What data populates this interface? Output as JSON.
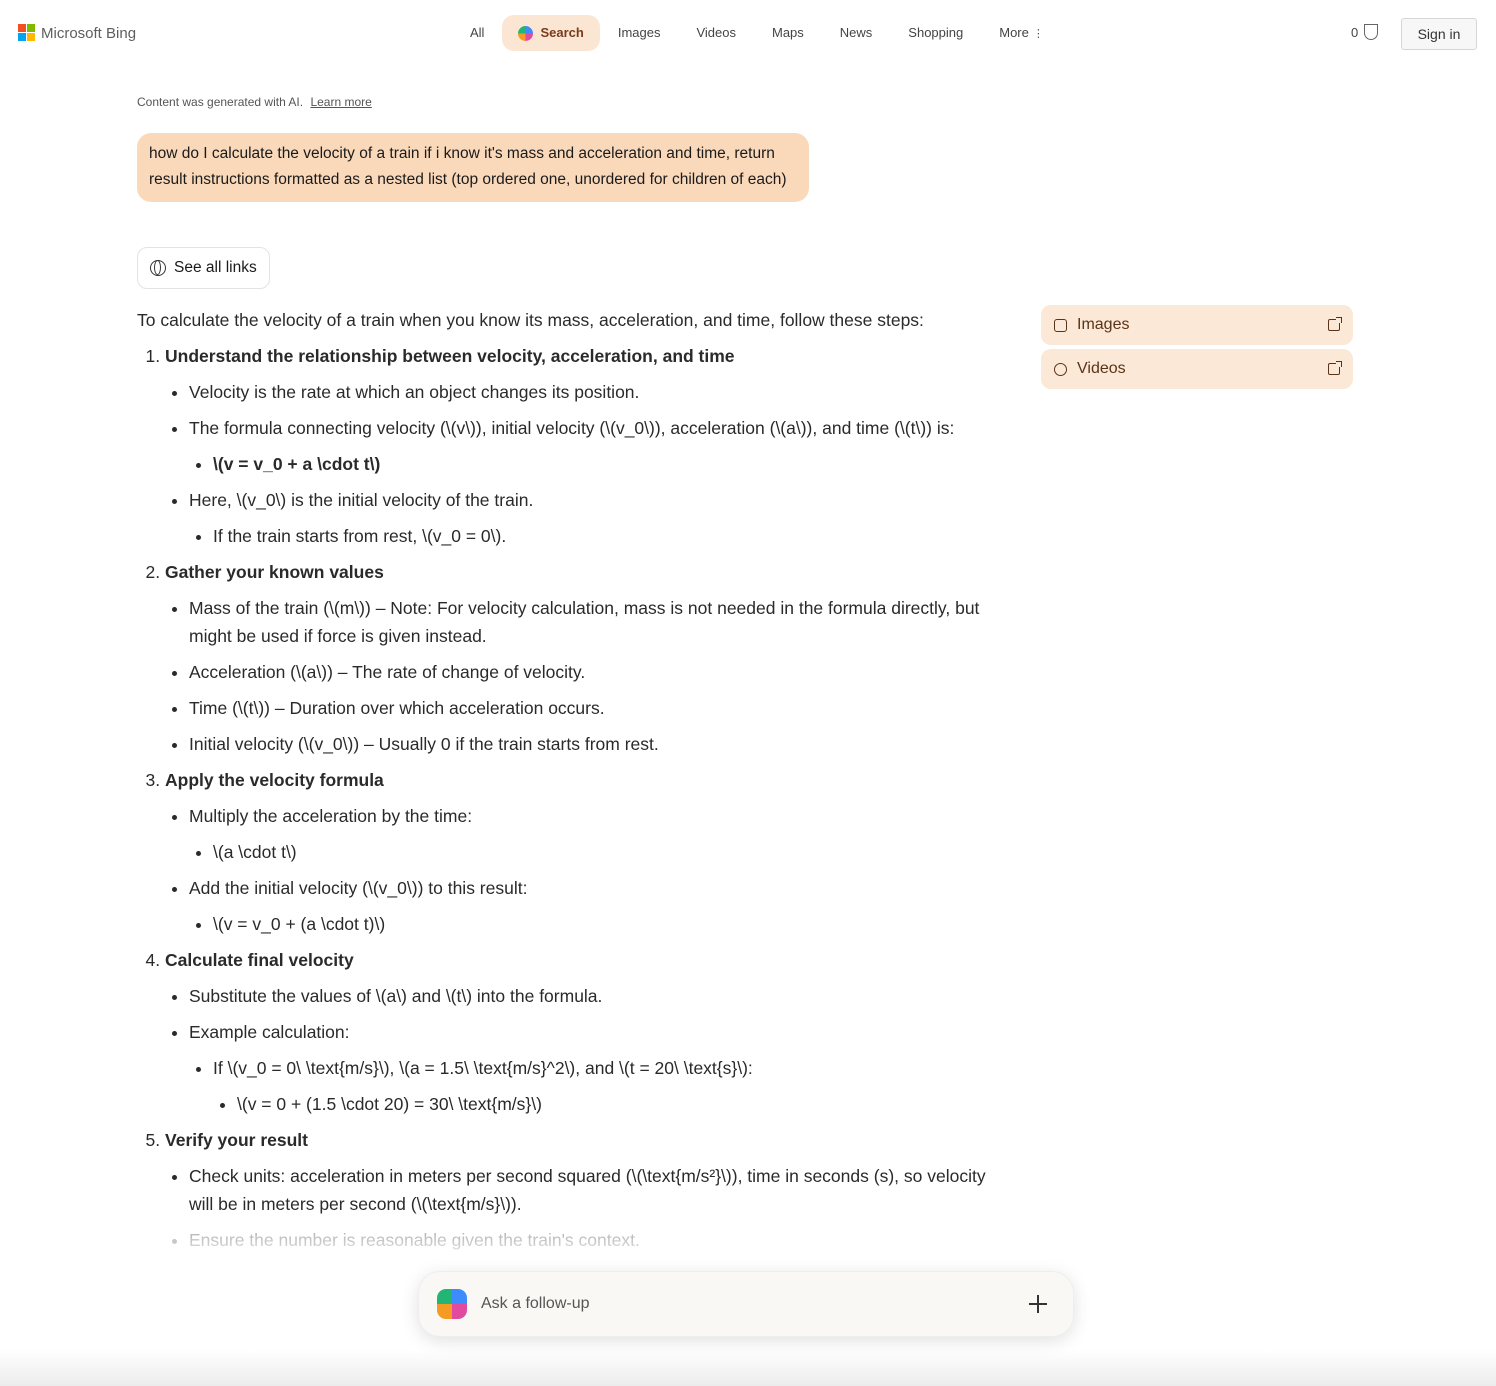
{
  "header": {
    "logo_text": "Microsoft Bing",
    "logo_colors": [
      "#f25022",
      "#7fba00",
      "#00a4ef",
      "#ffb900"
    ],
    "nav": [
      {
        "label": "All"
      },
      {
        "label": "Search",
        "active": true
      },
      {
        "label": "Images"
      },
      {
        "label": "Videos"
      },
      {
        "label": "Maps"
      },
      {
        "label": "News"
      },
      {
        "label": "Shopping"
      },
      {
        "label": "More"
      }
    ],
    "rewards_count": "0",
    "sign_in": "Sign in"
  },
  "notice": {
    "text": "Content was generated with AI.",
    "link": "Learn more"
  },
  "query": {
    "text": "how do I calculate the velocity of a train if i know it's mass and acceleration and time, return result instructions formatted as a nested list (top ordered one, unordered for children of each)"
  },
  "see_all_links": "See all links",
  "answer": {
    "intro": "To calculate the velocity of a train when you know its mass, acceleration, and time, follow these steps:",
    "steps": [
      {
        "title": "Understand the relationship between velocity, acceleration, and time",
        "b1": "Velocity is the rate at which an object changes its position.",
        "b2": "The formula connecting velocity (\\(v\\)), initial velocity (\\(v_0\\)), acceleration (\\(a\\)), and time (\\(t\\)) is:",
        "b2_sub": "\\(v = v_0 + a \\cdot t\\)",
        "b3": "Here, \\(v_0\\) is the initial velocity of the train.",
        "b3_sub": "If the train starts from rest, \\(v_0 = 0\\)."
      },
      {
        "title": "Gather your known values",
        "b1": "Mass of the train (\\(m\\)) – Note: For velocity calculation, mass is not needed in the formula directly, but might be used if force is given instead.",
        "b2": "Acceleration (\\(a\\)) – The rate of change of velocity.",
        "b3": "Time (\\(t\\)) – Duration over which acceleration occurs.",
        "b4": "Initial velocity (\\(v_0\\)) – Usually 0 if the train starts from rest."
      },
      {
        "title": "Apply the velocity formula",
        "b1": "Multiply the acceleration by the time:",
        "b1_sub": "\\(a \\cdot t\\)",
        "b2": "Add the initial velocity (\\(v_0\\)) to this result:",
        "b2_sub": "\\(v = v_0 + (a \\cdot t)\\)"
      },
      {
        "title": "Calculate final velocity",
        "b1": "Substitute the values of \\(a\\) and \\(t\\) into the formula.",
        "b2": "Example calculation:",
        "b2_sub": "If \\(v_0 = 0\\ \\text{m/s}\\), \\(a = 1.5\\ \\text{m/s}^2\\), and \\(t = 20\\ \\text{s}\\):",
        "b2_subsub": "\\(v = 0 + (1.5 \\cdot 20) = 30\\ \\text{m/s}\\)"
      },
      {
        "title": "Verify your result",
        "b1": "Check units: acceleration in meters per second squared (\\(\\text{m/s²}\\)), time in seconds (s), so velocity will be in meters per second (\\(\\text{m/s}\\)).",
        "b2": "Ensure the number is reasonable given the train's context."
      }
    ]
  },
  "side_panel": {
    "images": "Images",
    "videos": "Videos"
  },
  "followup": {
    "placeholder": "Ask a follow-up"
  },
  "colors": {
    "query_bubble": "#fad9ba",
    "active_tab": "#fbe6d3",
    "side_item": "#fbe8d6"
  },
  "icons": [
    "copilot-icon",
    "rewards-medal-icon",
    "globe-icon",
    "image-icon",
    "video-icon",
    "external-link-icon",
    "plus-icon"
  ]
}
